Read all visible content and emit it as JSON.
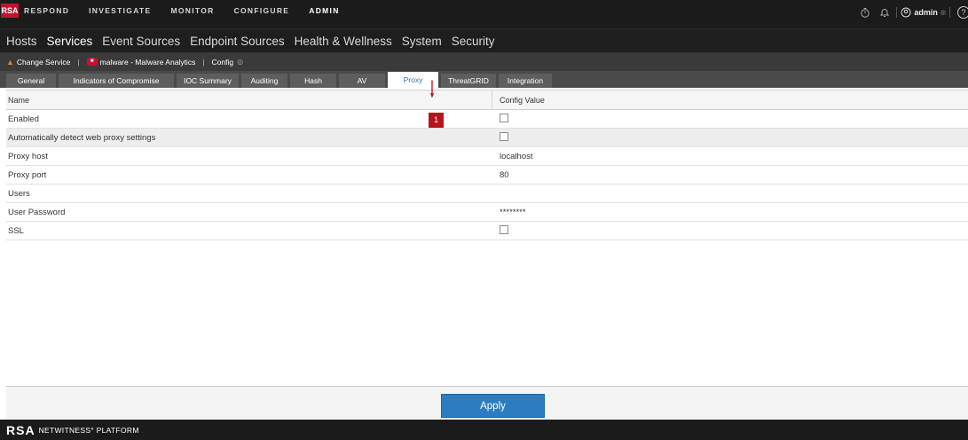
{
  "brand": {
    "logo": "RSA",
    "footer_logo": "RSA",
    "footer_name": "NETWITNESS° PLATFORM"
  },
  "top_nav": {
    "items": [
      "RESPOND",
      "INVESTIGATE",
      "MONITOR",
      "CONFIGURE",
      "ADMIN"
    ],
    "active": "ADMIN",
    "user": "admin",
    "icons": [
      "timer-icon",
      "bell-icon",
      "user-icon",
      "help-icon"
    ]
  },
  "sub_nav": {
    "items": [
      "Hosts",
      "Services",
      "Event Sources",
      "Endpoint Sources",
      "Health & Wellness",
      "System",
      "Security"
    ],
    "active": "Services"
  },
  "service_bar": {
    "change_service": "Change Service",
    "service_name": "malware - Malware Analytics",
    "view": "Config"
  },
  "tabs": {
    "items": [
      "General",
      "Indicators of Compromise",
      "IOC Summary",
      "Auditing",
      "Hash",
      "AV",
      "Proxy",
      "ThreatGRID",
      "Integration"
    ],
    "active": "Proxy"
  },
  "table": {
    "headers": {
      "name": "Name",
      "value": "Config Value"
    },
    "rows": [
      {
        "name": "Enabled",
        "type": "checkbox",
        "value": "",
        "checked": false
      },
      {
        "name": "Automatically detect web proxy settings",
        "type": "checkbox",
        "value": "",
        "checked": false
      },
      {
        "name": "Proxy host",
        "type": "text",
        "value": "localhost"
      },
      {
        "name": "Proxy port",
        "type": "text",
        "value": "80"
      },
      {
        "name": "Users",
        "type": "text",
        "value": ""
      },
      {
        "name": "User Password",
        "type": "text",
        "value": "********"
      },
      {
        "name": "SSL",
        "type": "checkbox",
        "value": "",
        "checked": false
      }
    ]
  },
  "annotation": {
    "badge": "1",
    "color": "#b4141c"
  },
  "actions": {
    "apply": "Apply"
  },
  "colors": {
    "accent": "#2b7cc0",
    "brand_red": "#c8102e",
    "active_tab_text": "#2f6fa7"
  }
}
